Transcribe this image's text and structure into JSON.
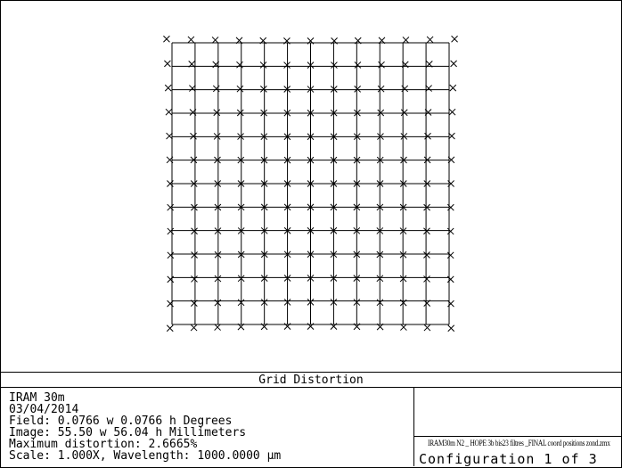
{
  "plot": {
    "title": "Grid Distortion",
    "grid_points": 13,
    "chief_field_max_deg": 0.0766,
    "maximum_distortion_percent": 2.6665
  },
  "info": {
    "system_name": "IRAM 30m",
    "date": "03/04/2014",
    "field": "Field: 0.0766 w 0.0766 h Degrees",
    "image": "Image: 55.50 w 56.04 h Millimeters",
    "max_distortion": "Maximum distortion: 2.6665%",
    "scale": "Scale: 1.000X, Wavelength: 1000.0000 µm"
  },
  "side": {
    "file_name": "IRAM30m N2 _ HOPE 3b bis23 filtres _FINAL coord positions zond.zmx",
    "configuration": "Configuration 1 of 3"
  },
  "colors": {
    "line": "#000000",
    "background": "#ffffff"
  }
}
